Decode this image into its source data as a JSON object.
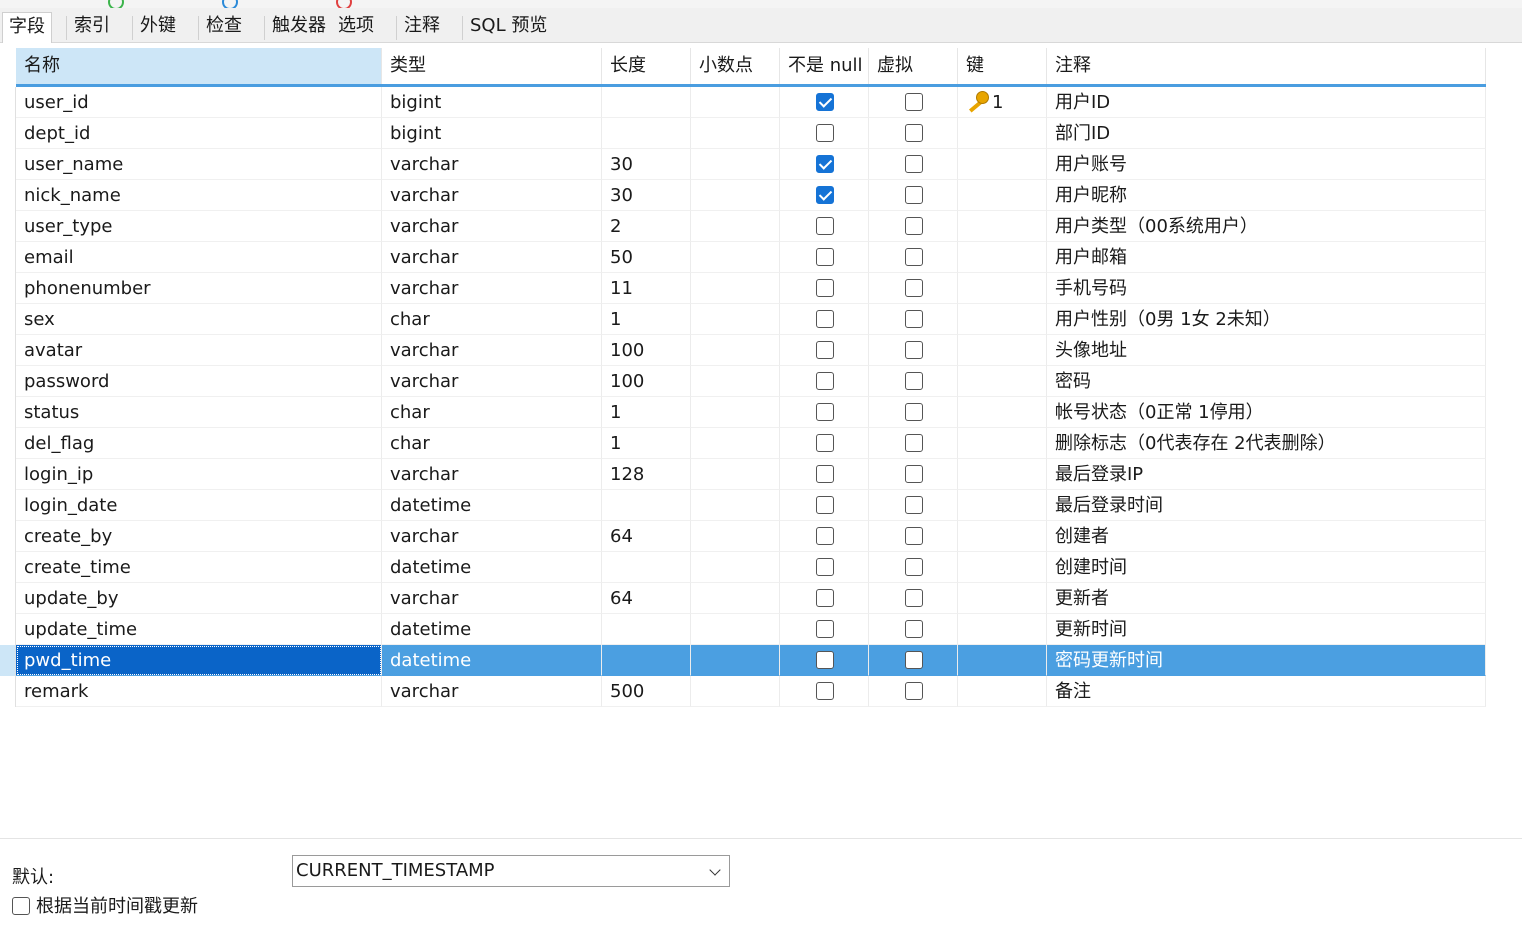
{
  "tabs": [
    {
      "label": "字段",
      "active": true
    },
    {
      "label": "索引"
    },
    {
      "label": "外键"
    },
    {
      "label": "检查"
    },
    {
      "label": "触发器"
    },
    {
      "label": "选项"
    },
    {
      "label": "注释"
    },
    {
      "label": "SQL 预览"
    }
  ],
  "columns": [
    "名称",
    "类型",
    "长度",
    "小数点",
    "不是 null",
    "虚拟",
    "键",
    "注释"
  ],
  "rows": [
    {
      "name": "user_id",
      "type": "bigint",
      "length": "",
      "decimals": "",
      "not_null": true,
      "virtual": false,
      "key": "1",
      "comment": "用户ID"
    },
    {
      "name": "dept_id",
      "type": "bigint",
      "length": "",
      "decimals": "",
      "not_null": false,
      "virtual": false,
      "key": "",
      "comment": "部门ID"
    },
    {
      "name": "user_name",
      "type": "varchar",
      "length": "30",
      "decimals": "",
      "not_null": true,
      "virtual": false,
      "key": "",
      "comment": "用户账号"
    },
    {
      "name": "nick_name",
      "type": "varchar",
      "length": "30",
      "decimals": "",
      "not_null": true,
      "virtual": false,
      "key": "",
      "comment": "用户昵称"
    },
    {
      "name": "user_type",
      "type": "varchar",
      "length": "2",
      "decimals": "",
      "not_null": false,
      "virtual": false,
      "key": "",
      "comment": "用户类型（00系统用户）"
    },
    {
      "name": "email",
      "type": "varchar",
      "length": "50",
      "decimals": "",
      "not_null": false,
      "virtual": false,
      "key": "",
      "comment": "用户邮箱"
    },
    {
      "name": "phonenumber",
      "type": "varchar",
      "length": "11",
      "decimals": "",
      "not_null": false,
      "virtual": false,
      "key": "",
      "comment": "手机号码"
    },
    {
      "name": "sex",
      "type": "char",
      "length": "1",
      "decimals": "",
      "not_null": false,
      "virtual": false,
      "key": "",
      "comment": "用户性别（0男 1女 2未知）"
    },
    {
      "name": "avatar",
      "type": "varchar",
      "length": "100",
      "decimals": "",
      "not_null": false,
      "virtual": false,
      "key": "",
      "comment": "头像地址"
    },
    {
      "name": "password",
      "type": "varchar",
      "length": "100",
      "decimals": "",
      "not_null": false,
      "virtual": false,
      "key": "",
      "comment": "密码"
    },
    {
      "name": "status",
      "type": "char",
      "length": "1",
      "decimals": "",
      "not_null": false,
      "virtual": false,
      "key": "",
      "comment": "帐号状态（0正常 1停用）"
    },
    {
      "name": "del_flag",
      "type": "char",
      "length": "1",
      "decimals": "",
      "not_null": false,
      "virtual": false,
      "key": "",
      "comment": "删除标志（0代表存在 2代表删除）"
    },
    {
      "name": "login_ip",
      "type": "varchar",
      "length": "128",
      "decimals": "",
      "not_null": false,
      "virtual": false,
      "key": "",
      "comment": "最后登录IP"
    },
    {
      "name": "login_date",
      "type": "datetime",
      "length": "",
      "decimals": "",
      "not_null": false,
      "virtual": false,
      "key": "",
      "comment": "最后登录时间"
    },
    {
      "name": "create_by",
      "type": "varchar",
      "length": "64",
      "decimals": "",
      "not_null": false,
      "virtual": false,
      "key": "",
      "comment": "创建者"
    },
    {
      "name": "create_time",
      "type": "datetime",
      "length": "",
      "decimals": "",
      "not_null": false,
      "virtual": false,
      "key": "",
      "comment": "创建时间"
    },
    {
      "name": "update_by",
      "type": "varchar",
      "length": "64",
      "decimals": "",
      "not_null": false,
      "virtual": false,
      "key": "",
      "comment": "更新者"
    },
    {
      "name": "update_time",
      "type": "datetime",
      "length": "",
      "decimals": "",
      "not_null": false,
      "virtual": false,
      "key": "",
      "comment": "更新时间"
    },
    {
      "name": "pwd_time",
      "type": "datetime",
      "length": "",
      "decimals": "",
      "not_null": false,
      "virtual": false,
      "key": "",
      "comment": "密码更新时间",
      "selected": true
    },
    {
      "name": "remark",
      "type": "varchar",
      "length": "500",
      "decimals": "",
      "not_null": false,
      "virtual": false,
      "key": "",
      "comment": "备注"
    }
  ],
  "bottom": {
    "default_label": "默认:",
    "default_value": "CURRENT_TIMESTAMP",
    "update_on_timestamp_label": "根据当前时间戳更新",
    "update_on_timestamp_checked": false
  },
  "colors": {
    "selection": "#4b9fe1",
    "header_underline": "#4a9de0",
    "checkbox_on": "#1573d6",
    "key_icon": "#e8a500"
  }
}
